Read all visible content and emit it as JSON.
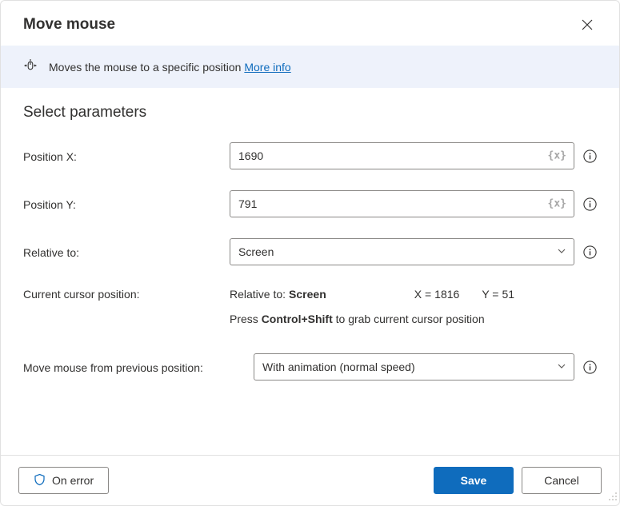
{
  "dialog": {
    "title": "Move mouse"
  },
  "banner": {
    "text": "Moves the mouse to a specific position",
    "link_label": "More info"
  },
  "section": {
    "heading": "Select parameters"
  },
  "fields": {
    "positionX": {
      "label": "Position X:",
      "value": "1690",
      "var_hint": "{x}"
    },
    "positionY": {
      "label": "Position Y:",
      "value": "791",
      "var_hint": "{x}"
    },
    "relativeTo": {
      "label": "Relative to:",
      "value": "Screen"
    },
    "currentCursor": {
      "label": "Current cursor position:",
      "relative_label": "Relative to:",
      "relative_value": "Screen",
      "x_label": "X =",
      "x_value": "1816",
      "y_label": "Y =",
      "y_value": "51",
      "hint_prefix": "Press ",
      "hint_keys": "Control+Shift",
      "hint_suffix": " to grab current cursor position"
    },
    "moveFrom": {
      "label": "Move mouse from previous position:",
      "value": "With animation (normal speed)"
    }
  },
  "footer": {
    "on_error": "On error",
    "save": "Save",
    "cancel": "Cancel"
  }
}
